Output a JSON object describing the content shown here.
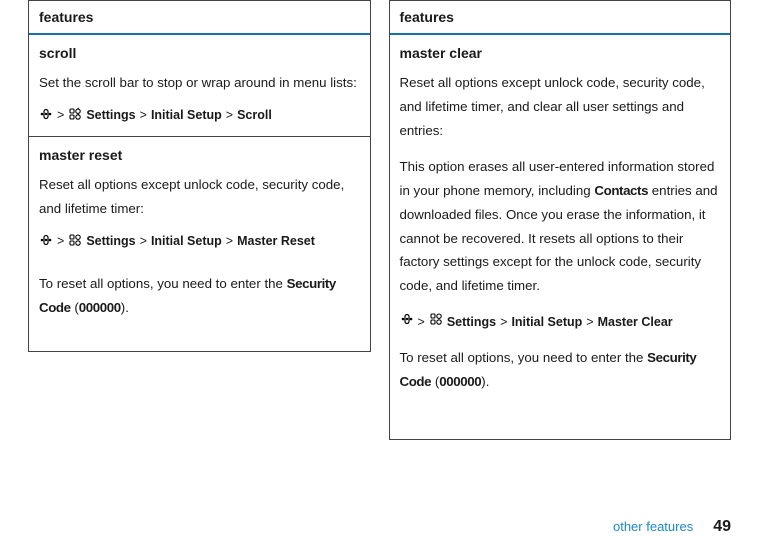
{
  "left": {
    "header": "features",
    "sections": [
      {
        "title": "scroll",
        "body_parts": [
          "Set the scroll bar to stop or wrap around in menu lists:"
        ],
        "path": [
          "Settings",
          "Initial Setup",
          "Scroll"
        ]
      },
      {
        "title": "master reset",
        "body_parts": [
          "Reset all options except unlock code, security code, and lifetime timer:"
        ],
        "path": [
          "Settings",
          "Initial Setup",
          "Master Reset"
        ],
        "after_path_prefix": "To reset all options, you need to enter the ",
        "after_path_bold1": "Security Code",
        "after_path_mid": " (",
        "after_path_bold2": "000000",
        "after_path_suffix": ")."
      }
    ]
  },
  "right": {
    "header": "features",
    "section": {
      "title": "master clear",
      "body1": "Reset all options except unlock code, security code, and lifetime timer, and clear all user settings and entries:",
      "body2_pre": "This option erases all user-entered information stored in your phone memory, including ",
      "body2_bold": "Contacts",
      "body2_post": " entries and downloaded files. Once you erase the information, it cannot be recovered. It resets all options to their factory settings except for the unlock code, security code, and lifetime timer.",
      "path": [
        "Settings",
        "Initial Setup",
        "Master Clear"
      ],
      "after_path_prefix": "To reset all options, you need to enter the ",
      "after_path_bold1": "Security Code",
      "after_path_mid": " (",
      "after_path_bold2": "000000",
      "after_path_suffix": ")."
    }
  },
  "footer": {
    "label": "other features",
    "page": "49"
  },
  "gt": ">"
}
